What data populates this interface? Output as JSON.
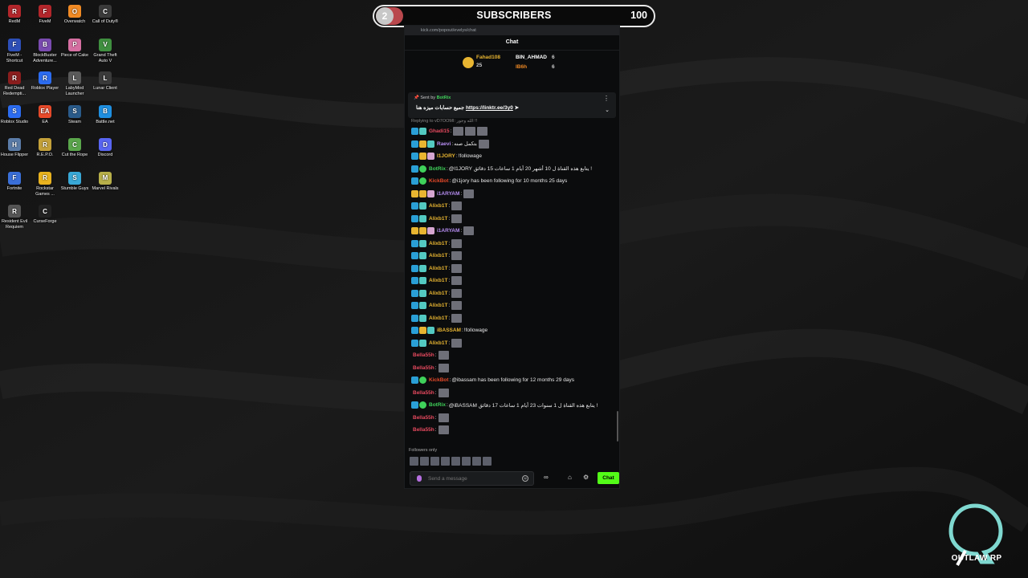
{
  "desktop_icons": [
    {
      "label": "RedM",
      "color": "#b3262b",
      "glyph": "R"
    },
    {
      "label": "FiveM",
      "color": "#b3262b",
      "glyph": "F"
    },
    {
      "label": "Overwatch",
      "color": "#f08a24",
      "glyph": "O"
    },
    {
      "label": "Call of Duty®",
      "color": "#3a3a3a",
      "glyph": "C"
    },
    {
      "label": "FiveM - Shortcut",
      "color": "#2d4fb8",
      "glyph": "F"
    },
    {
      "label": "BlockBuster Adventure...",
      "color": "#7a4bb0",
      "glyph": "B"
    },
    {
      "label": "Piece of Cake",
      "color": "#d66fa2",
      "glyph": "P"
    },
    {
      "label": "Grand Theft Auto V",
      "color": "#3f8f3f",
      "glyph": "V"
    },
    {
      "label": "Red Dead Redempti...",
      "color": "#8a1d1d",
      "glyph": "R"
    },
    {
      "label": "Roblox Player",
      "color": "#2c6cf0",
      "glyph": "R"
    },
    {
      "label": "LabyMod Launcher",
      "color": "#5a5a5a",
      "glyph": "L"
    },
    {
      "label": "Lunar Client",
      "color": "#3a3a3a",
      "glyph": "L"
    },
    {
      "label": "Roblox Studio",
      "color": "#2c6cf0",
      "glyph": "S"
    },
    {
      "label": "EA",
      "color": "#e84a2a",
      "glyph": "EA"
    },
    {
      "label": "Steam",
      "color": "#2a5b8a",
      "glyph": "S"
    },
    {
      "label": "Battle.net",
      "color": "#1f8fe0",
      "glyph": "B"
    },
    {
      "label": "House Flipper",
      "color": "#5b7ca8",
      "glyph": "H"
    },
    {
      "label": "R.E.P.O.",
      "color": "#c4a13a",
      "glyph": "R"
    },
    {
      "label": "Cut the Rope",
      "color": "#5aa64b",
      "glyph": "C"
    },
    {
      "label": "Discord",
      "color": "#5865f2",
      "glyph": "D"
    },
    {
      "label": "Fortnite",
      "color": "#3a6fd8",
      "glyph": "F"
    },
    {
      "label": "Rockstar Games ...",
      "color": "#e8b21f",
      "glyph": "R"
    },
    {
      "label": "Stumble Guys",
      "color": "#39a8d6",
      "glyph": "S"
    },
    {
      "label": "Marvel Rivals",
      "color": "#b8b04a",
      "glyph": "M"
    },
    {
      "label": "Resident Evil Requiem",
      "color": "#555555",
      "glyph": "R"
    },
    {
      "label": "CurseForge",
      "color": "#222222",
      "glyph": "C"
    }
  ],
  "subscriber_goal": {
    "current": "2",
    "label": "SUBSCRIBERS",
    "goal": "100",
    "progress": 0.02
  },
  "browser": {
    "url": "kick.com/popout/evelys/chat"
  },
  "chat": {
    "title": "Chat",
    "leaderboard": [
      {
        "name": "Fahad108",
        "count": "25",
        "color": "#e8b531"
      },
      {
        "name": "BIN_AHMAD",
        "count": "6",
        "color": "#ffffff"
      },
      {
        "name": "lB6h",
        "count": "6",
        "color": "#f08a24"
      }
    ],
    "pinned": {
      "sent_by_prefix": "Sent by",
      "sender": "BotRix",
      "message": "جميع حسابات ميزه هنا",
      "link": "https://linktr.ee/3y0"
    },
    "reply_note": "Replying to vD7OOMI: الله وجور !!",
    "messages": [
      {
        "user": "Ghadi15",
        "color": "#e84a5f",
        "text": "",
        "emotes": 3,
        "badges": [
          "k",
          "t"
        ]
      },
      {
        "user": "Raevi",
        "color": "#b58cf0",
        "text": "بتكمل صنه",
        "emotes": 1,
        "badges": [
          "k",
          "g",
          "t"
        ]
      },
      {
        "user": "I1JORY",
        "color": "#e8b531",
        "text": "!followage",
        "emotes": 0,
        "badges": [
          "k",
          "g",
          "v"
        ]
      },
      {
        "user": "BotRix",
        "color": "#3fd15a",
        "text": "@I1JORY يتابع هذه القناة ل 10 أشهر 20 أيام 1 ساعات 15 دقائق !",
        "emotes": 0,
        "badges": [
          "k",
          "e"
        ]
      },
      {
        "user": "KickBot",
        "color": "#e84a2a",
        "text": "@i1jory has been following for 10 months 25 days",
        "emotes": 0,
        "badges": [
          "k",
          "e"
        ]
      },
      {
        "user": "i1ARYAM",
        "color": "#b58cf0",
        "text": "",
        "emotes": 1,
        "badges": [
          "g",
          "g",
          "v"
        ]
      },
      {
        "user": "Alixb1T",
        "color": "#e8b531",
        "text": "",
        "emotes": 1,
        "badges": [
          "k",
          "t"
        ]
      },
      {
        "user": "Alixb1T",
        "color": "#e8b531",
        "text": "",
        "emotes": 1,
        "badges": [
          "k",
          "t"
        ]
      },
      {
        "user": "i1ARYAM",
        "color": "#b58cf0",
        "text": "",
        "emotes": 1,
        "badges": [
          "g",
          "g",
          "v"
        ]
      },
      {
        "user": "Alixb1T",
        "color": "#e8b531",
        "text": "",
        "emotes": 1,
        "badges": [
          "k",
          "t"
        ]
      },
      {
        "user": "Alixb1T",
        "color": "#e8b531",
        "text": "",
        "emotes": 1,
        "badges": [
          "k",
          "t"
        ]
      },
      {
        "user": "Alixb1T",
        "color": "#e8b531",
        "text": "",
        "emotes": 1,
        "badges": [
          "k",
          "t"
        ]
      },
      {
        "user": "Alixb1T",
        "color": "#e8b531",
        "text": "",
        "emotes": 1,
        "badges": [
          "k",
          "t"
        ]
      },
      {
        "user": "Alixb1T",
        "color": "#e8b531",
        "text": "",
        "emotes": 1,
        "badges": [
          "k",
          "t"
        ]
      },
      {
        "user": "Alixb1T",
        "color": "#e8b531",
        "text": "",
        "emotes": 1,
        "badges": [
          "k",
          "t"
        ]
      },
      {
        "user": "Alixb1T",
        "color": "#e8b531",
        "text": "",
        "emotes": 1,
        "badges": [
          "k",
          "t"
        ]
      },
      {
        "user": "iBASSAM",
        "color": "#e8b531",
        "text": "!followage",
        "emotes": 0,
        "badges": [
          "k",
          "g",
          "t"
        ]
      },
      {
        "user": "Alixb1T",
        "color": "#e8b531",
        "text": "",
        "emotes": 1,
        "badges": [
          "k",
          "t"
        ]
      },
      {
        "user": "Bella55h",
        "color": "#e84a5f",
        "text": "",
        "emotes": 1,
        "badges": []
      },
      {
        "user": "Bella55h",
        "color": "#e84a5f",
        "text": "",
        "emotes": 1,
        "badges": []
      },
      {
        "user": "KickBot",
        "color": "#e84a2a",
        "text": "@ibassam has been following for 12 months 29 days",
        "emotes": 0,
        "badges": [
          "k",
          "e"
        ]
      },
      {
        "user": "Bella55h",
        "color": "#e84a5f",
        "text": "",
        "emotes": 1,
        "badges": []
      },
      {
        "user": "BotRix",
        "color": "#3fd15a",
        "text": "@iBASSAM يتابع هذه القناة ل 1 سنوات 23 أيام 1 ساعات 17 دقائق !",
        "emotes": 0,
        "badges": [
          "k",
          "e"
        ]
      },
      {
        "user": "Bella55h",
        "color": "#e84a5f",
        "text": "",
        "emotes": 1,
        "badges": []
      },
      {
        "user": "Bella55h",
        "color": "#e84a5f",
        "text": "",
        "emotes": 1,
        "badges": []
      }
    ],
    "followers_only": "Followers only",
    "input_placeholder": "Send a message",
    "send_label": "Chat"
  },
  "logo": {
    "text": "OUTLAW RP"
  }
}
